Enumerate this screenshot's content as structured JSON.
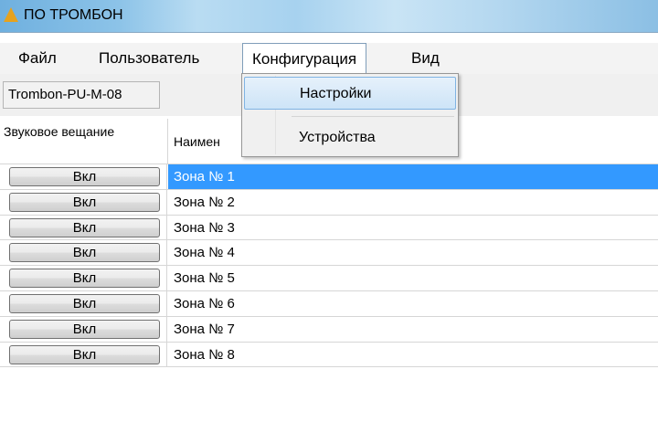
{
  "window": {
    "title": "ПО ТРОМБОН",
    "icon": "warning-triangle-icon"
  },
  "menubar": {
    "items": [
      {
        "label": "Файл"
      },
      {
        "label": "Пользователь"
      },
      {
        "label": "Конфигурация"
      },
      {
        "label": "Вид"
      }
    ],
    "open_menu": "Конфигурация"
  },
  "toolbar": {
    "server_label": "Trombon-PU-M-08"
  },
  "dropdown": {
    "items": [
      {
        "label": "Настройки",
        "highlighted": true
      },
      {
        "label": "Устройства",
        "highlighted": false
      }
    ]
  },
  "grid": {
    "columns": [
      {
        "header": "Звуковое вещание"
      },
      {
        "header": "Наимен"
      }
    ],
    "rows": [
      {
        "button": "Вкл",
        "name": "Зона № 1",
        "selected": true
      },
      {
        "button": "Вкл",
        "name": "Зона № 2",
        "selected": false
      },
      {
        "button": "Вкл",
        "name": "Зона № 3",
        "selected": false
      },
      {
        "button": "Вкл",
        "name": "Зона № 4",
        "selected": false
      },
      {
        "button": "Вкл",
        "name": "Зона № 5",
        "selected": false
      },
      {
        "button": "Вкл",
        "name": "Зона № 6",
        "selected": false
      },
      {
        "button": "Вкл",
        "name": "Зона № 7",
        "selected": false
      },
      {
        "button": "Вкл",
        "name": "Зона № 8",
        "selected": false
      }
    ]
  },
  "colors": {
    "selection": "#3399ff",
    "menu_highlight_border": "#7fb3e3"
  }
}
